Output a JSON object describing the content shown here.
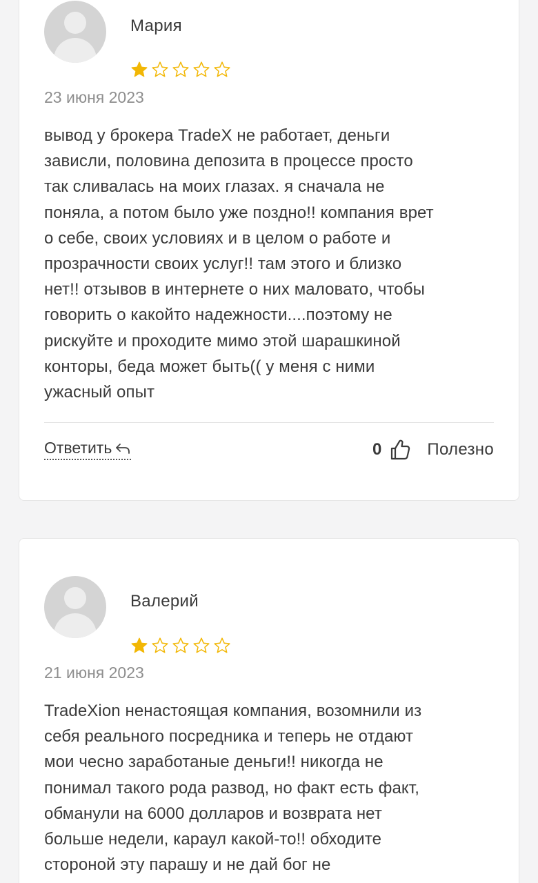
{
  "colors": {
    "star_filled": "#f2b705",
    "star_empty_stroke": "#f2b705",
    "avatar_bg": "#d4d4d4"
  },
  "reviews": [
    {
      "author": "Мария",
      "rating": 1,
      "rating_max": 5,
      "date": "23 июня 2023",
      "text_lines": [
        "вывод у брокера TradeX не работает, деньги",
        "зависли, половина депозита в процессе просто",
        "так сливалась на моих глазах. я сначала не",
        "поняла, а потом было уже поздно!! компания врет",
        "о себе, своих условиях и в целом о работе и",
        "прозрачности своих услуг!! там этого и близко",
        "нет!! отзывов в интернете о них маловато, чтобы",
        "говорить о какойто надежности....поэтому не",
        "рискуйте и проходите мимо этой шарашкиной",
        "конторы, беда может быть(( у меня с ними",
        "ужасный опыт"
      ],
      "reply_label": "Ответить",
      "reply_icon": "reply-arrow-icon",
      "useful_count": "0",
      "useful_icon": "thumbs-up-icon",
      "useful_label": "Полезно"
    },
    {
      "author": "Валерий",
      "rating": 1,
      "rating_max": 5,
      "date": "21 июня 2023",
      "text_lines": [
        "TradeXion ненастоящая компания, возомнили из",
        "себя реального посредника и теперь не отдают",
        "мои чесно заработаные деньги!! никогда не",
        "понимал такого рода развод, но факт есть факт,",
        "обманули на 6000 долларов и возврата нет",
        "больше недели, караул какой-то!! обходите",
        "стороной эту парашу и не дай бог не"
      ]
    }
  ]
}
